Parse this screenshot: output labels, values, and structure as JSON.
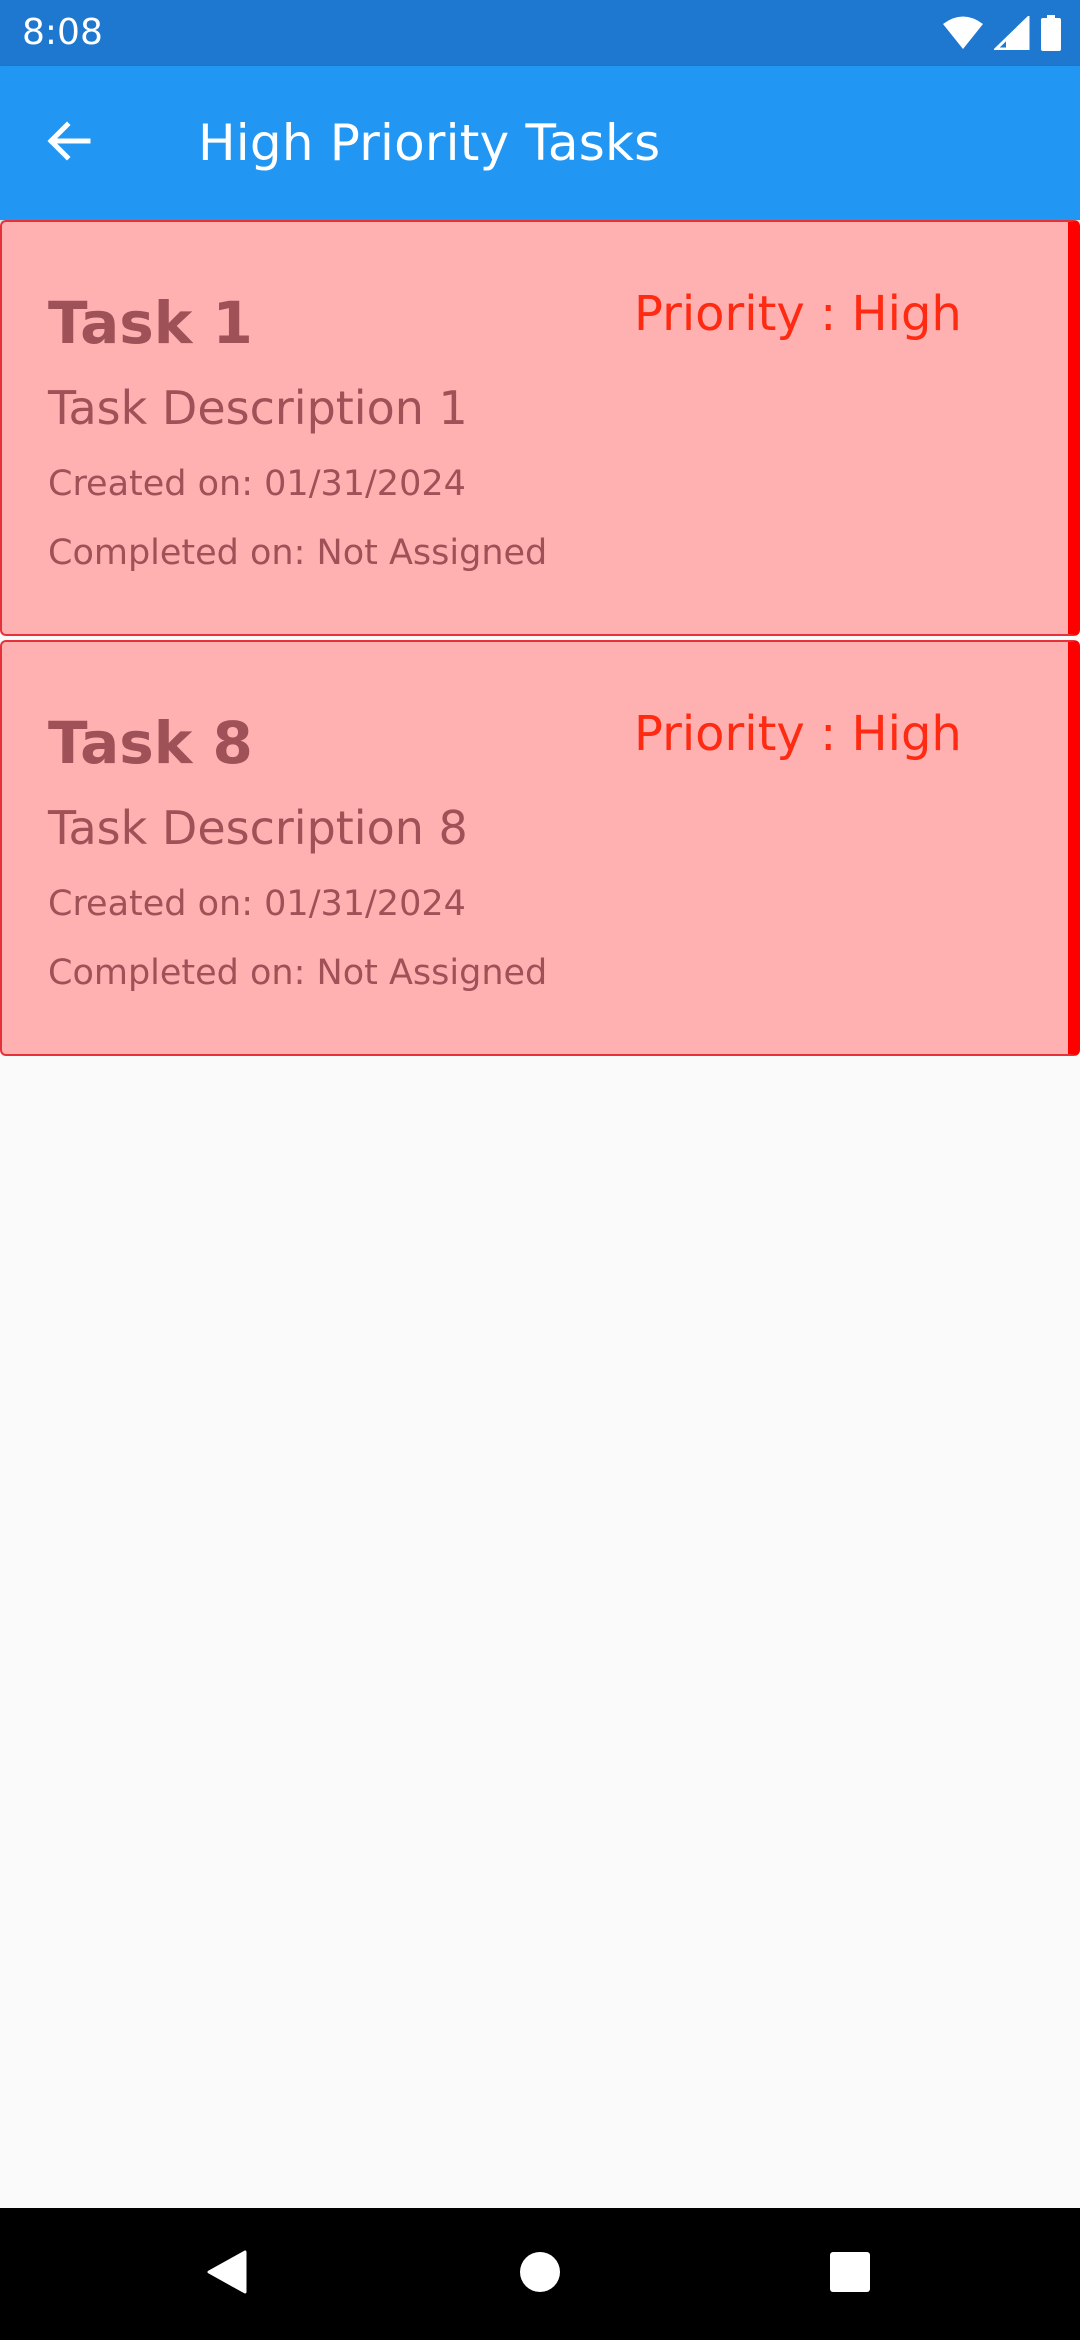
{
  "status_bar": {
    "time": "8:08",
    "icons": [
      "wifi-icon",
      "signal-icon",
      "battery-icon"
    ]
  },
  "app_bar": {
    "back_icon": "arrow-left-icon",
    "title": "High Priority Tasks",
    "background_color": "#2196F3"
  },
  "tasks": [
    {
      "title": "Task 1",
      "priority": "Priority : High",
      "description": "Task Description 1",
      "created": "Created on: 01/31/2024",
      "completed": "Completed on: Not Assigned"
    },
    {
      "title": "Task 8",
      "priority": "Priority : High",
      "description": "Task Description 8",
      "created": "Created on: 01/31/2024",
      "completed": "Completed on: Not Assigned"
    }
  ],
  "colors": {
    "card_background": "#FFB1B2",
    "card_accent": "#FF0000",
    "priority_text": "#FF2A12",
    "card_text": "#9E5156"
  },
  "nav_bar": {
    "icons": [
      "back-triangle-icon",
      "home-circle-icon",
      "recents-square-icon"
    ]
  }
}
